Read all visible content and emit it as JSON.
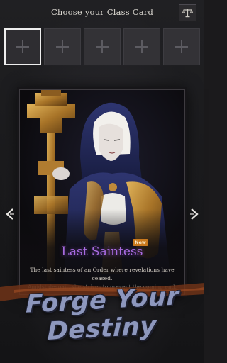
{
  "header": {
    "title": "Choose your Class Card",
    "scale_icon": "balance-scale-icon"
  },
  "slots": [
    {
      "state": "selected",
      "icon": "plus-icon"
    },
    {
      "state": "empty",
      "icon": "plus-icon"
    },
    {
      "state": "empty",
      "icon": "plus-icon"
    },
    {
      "state": "empty",
      "icon": "plus-icon"
    },
    {
      "state": "empty",
      "icon": "plus-icon"
    }
  ],
  "card": {
    "badge": "New",
    "name": "Last Saintess",
    "description_line1": "The last saintess of an Order where revelations have ceased.",
    "description_line2": "Amidst despair, she strives to prevent the coming end."
  },
  "navigation": {
    "prev_icon": "arrow-left-icon",
    "next_icon": "arrow-right-icon"
  },
  "banner": {
    "line1": "Forge Your",
    "line2": "Destiny"
  },
  "colors": {
    "background": "#1b1a1c",
    "class_name": "#a86be0",
    "badge": "#c9791d",
    "banner_text": "#8d97bd",
    "rust": "#7a3a1c"
  }
}
